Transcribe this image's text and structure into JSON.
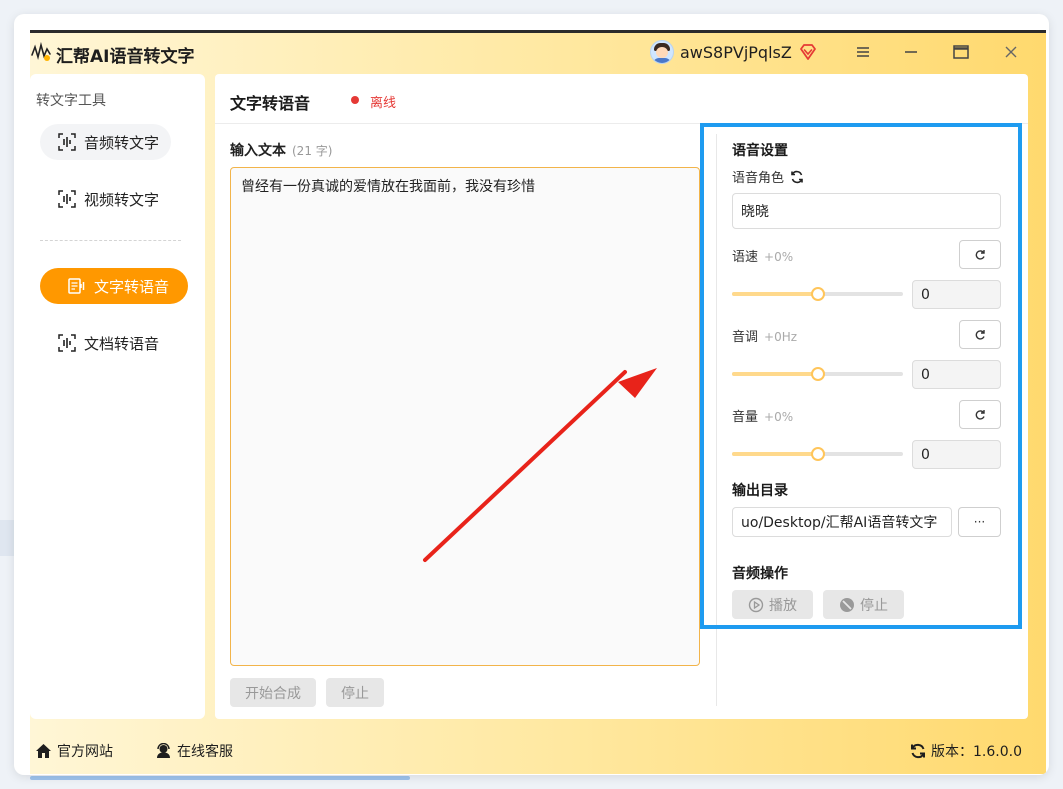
{
  "app": {
    "title": "汇帮AI语音转文字"
  },
  "user": {
    "name": "awS8PVjPqlsZ"
  },
  "sidebar": {
    "section_title": "转文字工具",
    "items": [
      {
        "label": "音频转文字"
      },
      {
        "label": "视频转文字"
      },
      {
        "label": "文字转语音"
      },
      {
        "label": "文档转语音"
      }
    ]
  },
  "main": {
    "title": "文字转语音",
    "status": "离线",
    "input_label": "输入文本",
    "char_count": "(21 字)",
    "input_text": "曾经有一份真诚的爱情放在我面前，我没有珍惜",
    "start_button": "开始合成",
    "stop_button": "停止"
  },
  "settings": {
    "title": "语音设置",
    "voice_role_label": "语音角色",
    "voice_role_value": "晓晓",
    "speed_label": "语速",
    "speed_hint": "+0%",
    "speed_value": "0",
    "speed_level": 0.5,
    "pitch_label": "音调",
    "pitch_hint": "+0Hz",
    "pitch_value": "0",
    "pitch_level": 0.5,
    "volume_label": "音量",
    "volume_hint": "+0%",
    "volume_value": "0",
    "volume_level": 0.5,
    "output_dir_label": "输出目录",
    "output_dir_value": "uo/Desktop/汇帮AI语音转文字",
    "browse_button": "···",
    "audio_ops_label": "音频操作",
    "play_button": "播放",
    "stop_button": "停止"
  },
  "footer": {
    "website": "官方网站",
    "support": "在线客服",
    "version": "版本：1.6.0.0"
  },
  "colors": {
    "accent": "#ff9800",
    "status_red": "#e53935",
    "highlight_blue": "#1e9bf0",
    "arrow_red": "#e8231a"
  }
}
